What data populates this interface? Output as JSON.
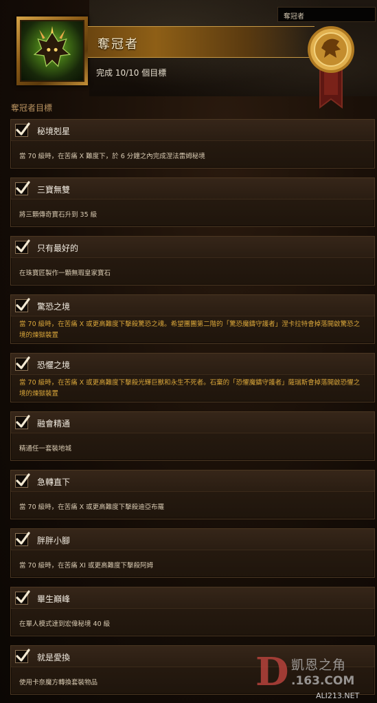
{
  "header": {
    "search_value": "奪冠者",
    "title": "奪冠者",
    "progress_text": "完成 10/10 個目標",
    "objectives_heading": "奪冠者目標"
  },
  "objectives": [
    {
      "title": "秘境剋星",
      "desc": "當 70 級時，在苦痛 X 難度下，於 6 分鐘之內完成涅法雷姆秘境",
      "done": true,
      "desc_color": "normal"
    },
    {
      "title": "三寶無雙",
      "desc": "將三顆傳奇寶石升到 35 級",
      "done": true,
      "desc_color": "normal"
    },
    {
      "title": "只有最好的",
      "desc": "在珠寶匠製作一顆無瑕皇家寶石",
      "done": true,
      "desc_color": "normal"
    },
    {
      "title": "驚恐之境",
      "desc": "當 70 級時，在苦痛 X 或更高難度下擊殺驚恐之魂。希望團團第二階的「驚恐魔鑄守護者」涅卡拉特會掉落開啟驚恐之境的煉獄裝置",
      "done": true,
      "desc_color": "gold"
    },
    {
      "title": "恐懼之境",
      "desc": "當 70 級時，在苦痛 X 或更高難度下擊殺光輝巨獸和永生不死者。石棄的「恐懼魔鑄守護者」薩瑞斯會掉落開啟恐懼之境的煉獄裝置",
      "done": true,
      "desc_color": "gold"
    },
    {
      "title": "融會精通",
      "desc": "精通任一套裝地城",
      "done": true,
      "desc_color": "normal"
    },
    {
      "title": "急轉直下",
      "desc": "當 70 級時，在苦痛 X 或更高難度下擊殺迪亞布羅",
      "done": true,
      "desc_color": "normal"
    },
    {
      "title": "胖胖小腳",
      "desc": "當 70 級時，在苦痛 XI 或更高難度下擊殺阿姆",
      "done": true,
      "desc_color": "normal"
    },
    {
      "title": "畢生巔峰",
      "desc": "在單人模式達到宏偉秘境 40 級",
      "done": true,
      "desc_color": "normal"
    },
    {
      "title": "就是愛換",
      "desc": "使用卡奈魔方轉換套裝物品",
      "done": true,
      "desc_color": "normal"
    }
  ],
  "watermark": {
    "logo": "D",
    "brand_cn": "凱恩之角",
    "brand_domain": ".163.COM",
    "site": "ALI213.NET"
  },
  "colors": {
    "accent_gold": "#c99a45",
    "desc_gold": "#d9a63a",
    "title_text": "#f1ebe1"
  }
}
